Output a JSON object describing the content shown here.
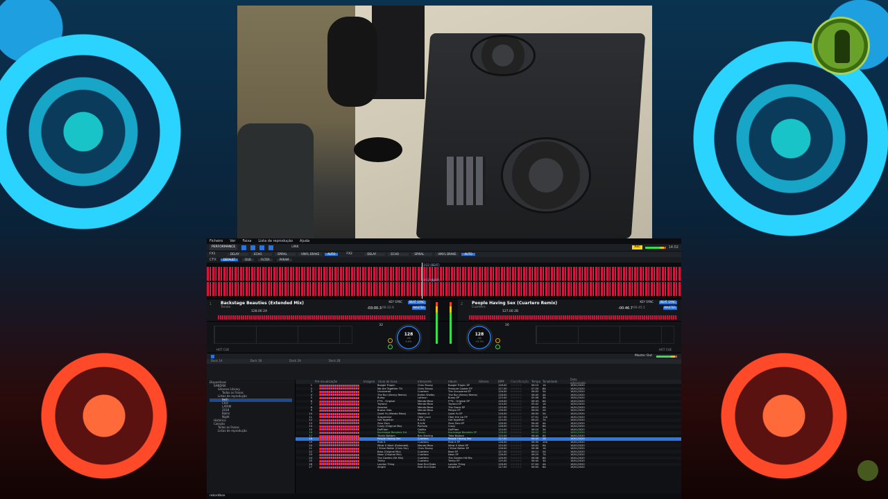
{
  "app": {
    "menu": [
      "Ficheiro",
      "Ver",
      "Faixa",
      "Lista de reprodução",
      "Ajuda"
    ],
    "mode": "PERFORMANCE",
    "link_label": "LINK",
    "rec_label": "Rec",
    "clock": "14:02",
    "fx": {
      "fx1_label": "FX1",
      "fx2_label": "FX2",
      "slots_left": [
        "DELAY",
        "ECHO",
        "SPIRAL",
        "VINYL BRAKE"
      ],
      "slots_right": [
        "DELAY",
        "ECHO",
        "SPIRAL",
        "VINYL BRAKE"
      ],
      "auto_label": "AUTO"
    },
    "cfx": {
      "label": "CFX",
      "default_label": "DEFAULT",
      "items": [
        "DUB",
        "FILTER",
        "PARAM"
      ]
    },
    "waveform": {
      "marker1": "2/32 (BEAT)",
      "marker2": "2/32 (BEAT)"
    },
    "deck1": {
      "num": "1",
      "title": "Backstage Beauties (Extended Mix)",
      "artist": "Tonian",
      "bpm_key": "128.00  2A",
      "time": "-03:00.3",
      "remain": "08:22.6",
      "key_sync_label": "KEY SYNC",
      "sync_label": "BEAT SYNC",
      "master_label": "MASTER",
      "loop": "32",
      "jog_bpm": "128",
      "jog_bpm_decimal": ".00",
      "jog_pct": "0.0%",
      "hotcue_label": "HOT CUE"
    },
    "deck2": {
      "num": "2",
      "title": "People Having Sex (Cuartero Remix)",
      "artist": "Cuartero",
      "bpm_key": "127.00  2B",
      "time": "-00:46.7",
      "remain": "06:45.1",
      "key_sync_label": "KEY SYNC",
      "sync_label": "BEAT SYNC",
      "master_label": "MASTER",
      "loop": "16",
      "jog_bpm": "128",
      "jog_bpm_decimal": ".00",
      "jog_pct": "+0.7%",
      "hotcue_label": "HOT CUE"
    },
    "master_out_label": "Master Out",
    "browser_tabs": [
      "Deck 1A",
      "Deck 1B",
      "Deck 2A",
      "Deck 2B"
    ],
    "tree": [
      {
        "label": "Dispositivos",
        "level": 0
      },
      {
        "label": "SANDISK",
        "level": 1
      },
      {
        "label": "Gêneros Library",
        "level": 2
      },
      {
        "label": "Todas as Faixas",
        "level": 3
      },
      {
        "label": "Listas de reprodução",
        "level": 2
      },
      {
        "label": "tech",
        "level": 3,
        "selected": true
      },
      {
        "label": "Chill",
        "level": 3
      },
      {
        "label": "LATAM",
        "level": 3
      },
      {
        "label": "2018",
        "level": 3
      },
      {
        "label": "Bailar",
        "level": 3
      },
      {
        "label": "Night",
        "level": 3
      },
      {
        "label": "Histórico",
        "level": 1
      },
      {
        "label": "Coleção",
        "level": 1
      },
      {
        "label": "Todas as Faixas",
        "level": 2
      },
      {
        "label": "Listas de reprodução",
        "level": 2
      }
    ],
    "track_header": {
      "num": "",
      "preview": "Pré-visualização",
      "art": "Imagem",
      "title": "Título da faixa",
      "artist": "Intérprete",
      "album": "Álbum",
      "genre": "Gênero",
      "bpm": "BPM",
      "rating": "Classificação",
      "time": "Tempo",
      "key": "Tonalidade",
      "date": "Data adicionada"
    },
    "tracks": [
      {
        "num": "1",
        "title": "Boogie Trippin",
        "artist": "Chris Stussy",
        "album": "Boogie Trippin EP",
        "bpm": "128.00",
        "time": "06:15",
        "key": "1A",
        "date": "16/01/2020"
      },
      {
        "num": "2",
        "title": "We Are Together Till",
        "artist": "Chris Stussy",
        "album": "Pressure Cooker EP",
        "bpm": "127.00",
        "time": "07:20",
        "key": "8A",
        "date": "16/01/2020"
      },
      {
        "num": "3",
        "title": "Uncovered",
        "artist": "Cuartero",
        "album": "The Uncovered EP",
        "bpm": "126.00",
        "time": "06:05",
        "key": "5A",
        "date": "16/01/2020"
      },
      {
        "num": "4",
        "title": "The Run (Kenny Remix)",
        "artist": "Kreter Shelby",
        "album": "The Run (Kenny Remix)",
        "bpm": "128.00",
        "time": "06:45",
        "key": "4A",
        "date": "16/01/2020"
      },
      {
        "num": "5",
        "title": "Bump",
        "artist": "Latmun",
        "album": "Bump EP",
        "bpm": "125.00",
        "time": "05:58",
        "key": "3A",
        "date": "16/01/2020"
      },
      {
        "num": "6",
        "title": "F**k - Original",
        "artist": "Mendo Mezz",
        "album": "F**k - Original EP",
        "bpm": "126.00",
        "time": "06:33",
        "key": "6A",
        "date": "16/01/2020"
      },
      {
        "num": "7",
        "title": "Toyland",
        "artist": "Mendo Mezz",
        "album": "Toyland EP",
        "bpm": "124.00",
        "time": "05:42",
        "key": "1A",
        "date": "16/01/2020"
      },
      {
        "num": "8",
        "title": "Sesame",
        "artist": "Mendo Mezz",
        "album": "The Grove EP",
        "bpm": "125.00",
        "time": "06:12",
        "key": "9A",
        "date": "16/01/2020"
      },
      {
        "num": "9",
        "title": "Buena Vida",
        "artist": "Mendo Mezz",
        "album": "Pelígro EP",
        "bpm": "128.00",
        "time": "06:04",
        "key": "2A",
        "date": "16/01/2020"
      },
      {
        "num": "10",
        "title": "Quiet Yu (Mendo Mezz)",
        "artist": "Modern G",
        "album": "Quiet Yu EP",
        "bpm": "126.00",
        "time": "06:50",
        "key": "5A",
        "date": "16/01/2020"
      },
      {
        "num": "11",
        "title": "Suspensive",
        "artist": "Ober Lucci",
        "album": "Ober the Lip EP",
        "bpm": "127.00",
        "time": "07:01",
        "key": "11A",
        "date": "16/01/2020"
      },
      {
        "num": "12",
        "title": "Get Together",
        "artist": "R.A.W.",
        "album": "Get Together",
        "bpm": "125.00",
        "time": "06:22",
        "key": "7A",
        "date": "16/01/2020"
      },
      {
        "num": "13",
        "title": "Zero Zero",
        "artist": "R.A.W.",
        "album": "Zero Zero EP",
        "bpm": "126.00",
        "time": "06:40",
        "key": "4A",
        "date": "16/01/2020"
      },
      {
        "num": "14",
        "title": "Crazy (Original Mix)",
        "artist": "Pochola",
        "album": "Crazy",
        "bpm": "128.00",
        "time": "05:55",
        "key": "8A",
        "date": "16/01/2020"
      },
      {
        "num": "15",
        "title": "DoPHam",
        "artist": "Qalitta",
        "album": "DoPHam",
        "bpm": "124.00",
        "time": "06:10",
        "key": "3A",
        "date": "16/01/2020"
      },
      {
        "num": "16",
        "title": "Backstage Beauties Ext",
        "artist": "Tonian",
        "album": "Backstage Beauties EP",
        "bpm": "128.00",
        "time": "06:22",
        "key": "2A",
        "date": "16/01/2020",
        "state": "green"
      },
      {
        "num": "17",
        "title": "Trickle Bottom",
        "artist": "Ben Sterling",
        "album": "Tribe Bottom",
        "bpm": "125.00",
        "time": "06:44",
        "key": "6A",
        "date": "16/01/2020"
      },
      {
        "num": "18",
        "title": "People Having Sex",
        "artist": "Cuartero",
        "album": "People Having Sex",
        "bpm": "127.00",
        "time": "06:45",
        "key": "2B",
        "date": "16/01/2020",
        "state": "highlight"
      },
      {
        "num": "19",
        "title": "Ride It",
        "artist": "Cuartero",
        "album": "Ride It EP",
        "bpm": "128.00",
        "time": "06:30",
        "key": "10A",
        "date": "16/01/2020"
      },
      {
        "num": "20",
        "title": "What U Want (Extended)",
        "artist": "Mendo Mezz",
        "album": "What U Want EP",
        "bpm": "125.00",
        "time": "06:02",
        "key": "9A",
        "date": "16/01/2020"
      },
      {
        "num": "21",
        "title": "I Shine Better (Chris Stu)",
        "artist": "Chris Stussy",
        "album": "I Shine Better EP",
        "bpm": "126.00",
        "time": "06:38",
        "key": "1A",
        "date": "16/01/2020"
      },
      {
        "num": "22",
        "title": "Bass (Original Mix)",
        "artist": "Cuartero",
        "album": "Bass EP",
        "bpm": "127.00",
        "time": "06:11",
        "key": "5A",
        "date": "16/01/2020"
      },
      {
        "num": "23",
        "title": "Neon (Original Mix)",
        "artist": "Cuartero",
        "album": "Neon EP",
        "bpm": "128.00",
        "time": "06:25",
        "key": "7A",
        "date": "16/01/2020"
      },
      {
        "num": "24",
        "title": "The Garden (Hit Mix)",
        "artist": "Cuartero",
        "album": "The Garden Hit Mix",
        "bpm": "126.00",
        "time": "06:08",
        "key": "8A",
        "date": "16/01/2020"
      },
      {
        "num": "25",
        "title": "Trinity",
        "artist": "Cuartero",
        "album": "Trinity EP",
        "bpm": "125.00",
        "time": "06:40",
        "key": "3A",
        "date": "16/01/2020"
      },
      {
        "num": "26",
        "title": "London Thing",
        "artist": "East End Dubs",
        "album": "London Thing",
        "bpm": "126.00",
        "time": "07:04",
        "key": "4A",
        "date": "16/01/2020"
      },
      {
        "num": "27",
        "title": "Alright",
        "artist": "East End Dubs",
        "album": "Alright EP",
        "bpm": "127.00",
        "time": "06:50",
        "key": "6A",
        "date": "16/01/2020"
      }
    ],
    "footer_brand": "rekordbox"
  }
}
